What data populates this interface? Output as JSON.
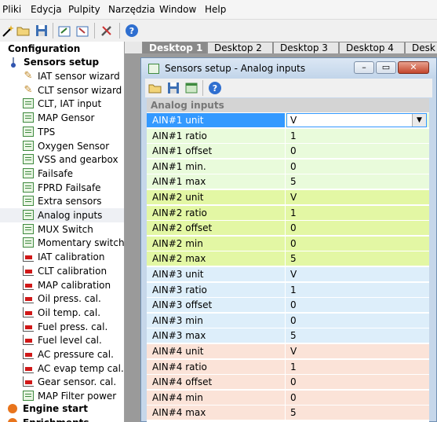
{
  "menu": [
    "Pliki",
    "Edycja",
    "Pulpity",
    "Narzędzia",
    "Window",
    "Help"
  ],
  "tree": {
    "root": "Configuration",
    "section": "Sensors setup",
    "items": [
      {
        "label": "IAT sensor wizard",
        "icon": "wizard-icon"
      },
      {
        "label": "CLT sensor wizard",
        "icon": "wizard-icon"
      },
      {
        "label": "CLT, IAT input",
        "icon": "grid-icon"
      },
      {
        "label": "MAP Gensor",
        "icon": "grid-icon"
      },
      {
        "label": "TPS",
        "icon": "grid-icon"
      },
      {
        "label": "Oxygen Sensor",
        "icon": "grid-icon"
      },
      {
        "label": "VSS and gearbox",
        "icon": "grid-icon"
      },
      {
        "label": "Failsafe",
        "icon": "grid-icon"
      },
      {
        "label": "FPRD Failsafe",
        "icon": "grid-icon"
      },
      {
        "label": "Extra sensors",
        "icon": "grid-icon"
      },
      {
        "label": "Analog inputs",
        "icon": "grid-icon"
      },
      {
        "label": "MUX Switch",
        "icon": "grid-icon"
      },
      {
        "label": "Momentary switch",
        "icon": "grid-icon"
      },
      {
        "label": "IAT calibration",
        "icon": "chart-icon"
      },
      {
        "label": "CLT calibration",
        "icon": "chart-icon"
      },
      {
        "label": "MAP calibration",
        "icon": "chart-icon"
      },
      {
        "label": "Oil press. cal.",
        "icon": "chart-icon"
      },
      {
        "label": "Oil temp. cal.",
        "icon": "chart-icon"
      },
      {
        "label": "Fuel press. cal.",
        "icon": "chart-icon"
      },
      {
        "label": "Fuel level cal.",
        "icon": "chart-icon"
      },
      {
        "label": "AC pressure cal.",
        "icon": "chart-icon"
      },
      {
        "label": "AC evap temp cal.",
        "icon": "chart-icon"
      },
      {
        "label": "Gear sensor. cal.",
        "icon": "chart-icon"
      },
      {
        "label": "MAP Filter power",
        "icon": "grid-icon"
      }
    ],
    "next_section": "Engine start",
    "next_section2": "Enrichments",
    "selected": "Analog inputs"
  },
  "desktop_tabs": [
    "Desktop 1",
    "Desktop 2",
    "Desktop 3",
    "Desktop 4",
    "Desk"
  ],
  "window": {
    "title": "Sensors setup - Analog inputs",
    "minimize": "–",
    "restore": "▭",
    "close": "✕"
  },
  "grid": {
    "header": "Analog inputs",
    "rows": [
      {
        "name": "AIN#1 unit",
        "value": "V",
        "group": 1
      },
      {
        "name": "AIN#1 ratio",
        "value": "1",
        "group": 1
      },
      {
        "name": "AIN#1 offset",
        "value": "0",
        "group": 1
      },
      {
        "name": "AIN#1 min.",
        "value": "0",
        "group": 1
      },
      {
        "name": "AIN#1 max",
        "value": "5",
        "group": 1
      },
      {
        "name": "AIN#2 unit",
        "value": "V",
        "group": 2
      },
      {
        "name": "AIN#2 ratio",
        "value": "1",
        "group": 2
      },
      {
        "name": "AIN#2 offset",
        "value": "0",
        "group": 2
      },
      {
        "name": "AIN#2 min",
        "value": "0",
        "group": 2
      },
      {
        "name": "AIN#2 max",
        "value": "5",
        "group": 2
      },
      {
        "name": "AIN#3 unit",
        "value": "V",
        "group": 3
      },
      {
        "name": "AIN#3 ratio",
        "value": "1",
        "group": 3
      },
      {
        "name": "AIN#3 offset",
        "value": "0",
        "group": 3
      },
      {
        "name": "AIN#3 min",
        "value": "0",
        "group": 3
      },
      {
        "name": "AIN#3 max",
        "value": "5",
        "group": 3
      },
      {
        "name": "AIN#4 unit",
        "value": "V",
        "group": 4
      },
      {
        "name": "AIN#4 ratio",
        "value": "1",
        "group": 4
      },
      {
        "name": "AIN#4 offset",
        "value": "0",
        "group": 4
      },
      {
        "name": "AIN#4 min",
        "value": "0",
        "group": 4
      },
      {
        "name": "AIN#4 max",
        "value": "5",
        "group": 4
      }
    ],
    "group_colors": {
      "1": "#e9fbdb",
      "2": "#e3f7a4",
      "3": "#ddeefa",
      "4": "#fbe3d8"
    },
    "selected_row": 0
  }
}
